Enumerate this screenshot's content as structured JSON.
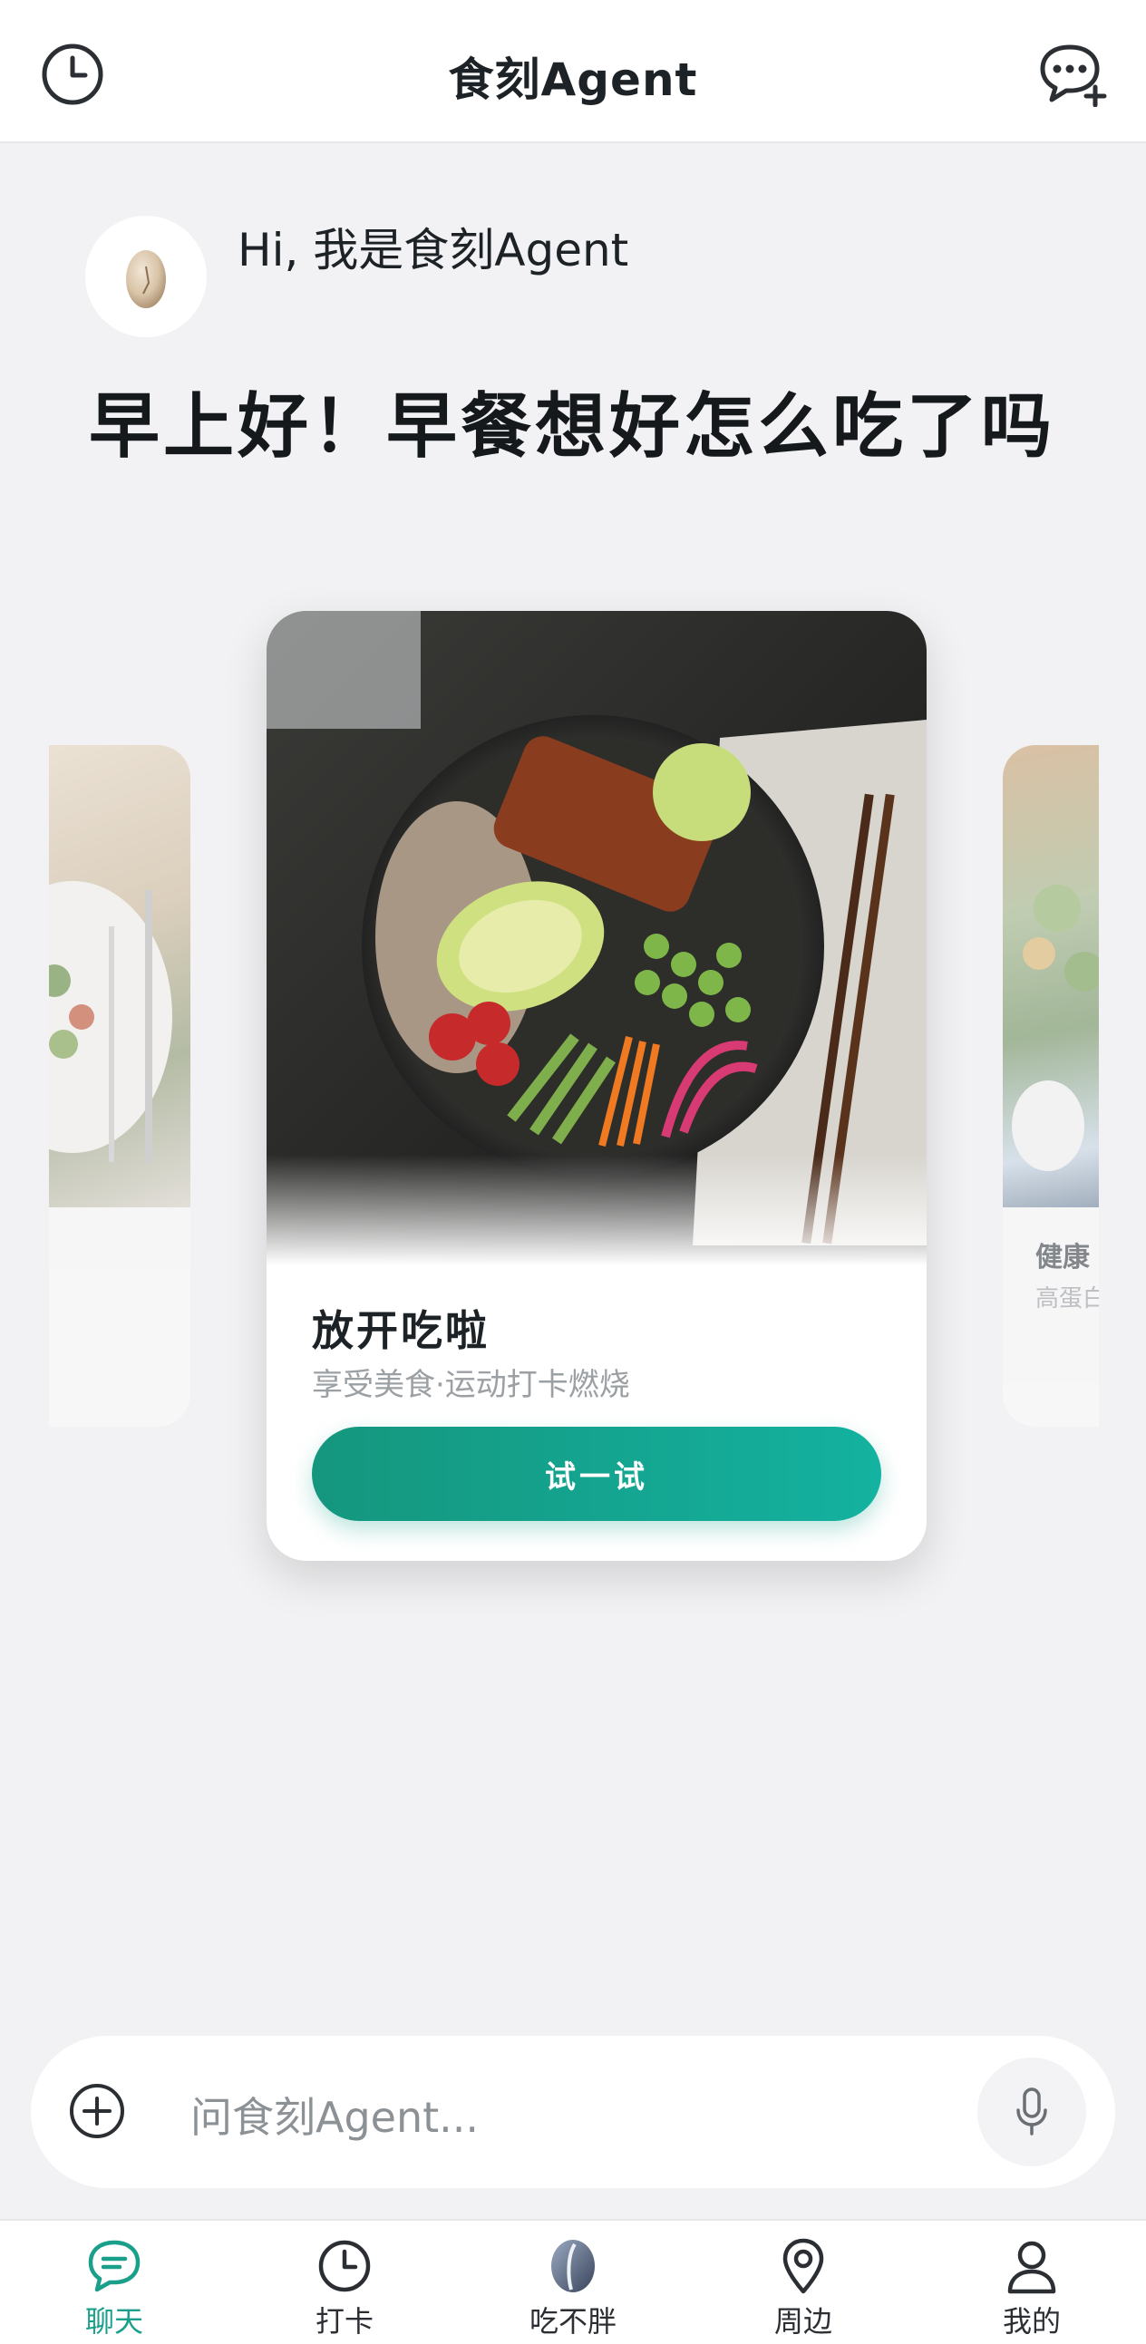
{
  "header": {
    "title": "食刻Agent",
    "history_icon": "clock-icon",
    "new_chat_icon": "chat-bubble-plus-icon"
  },
  "greeting": {
    "hi": "Hi, 我是食刻Agent",
    "headline": "早上好！早餐想好怎么吃了吗"
  },
  "cards": {
    "main": {
      "title": "放开吃啦",
      "subtitle": "享受美食·运动打卡燃烧",
      "button": "试一试"
    },
    "right": {
      "title": "健康",
      "subtitle": "高蛋白"
    }
  },
  "input": {
    "placeholder": "问食刻Agent...",
    "plus_icon": "plus-circle-icon",
    "mic_icon": "microphone-icon"
  },
  "nav": {
    "items": [
      {
        "label": "聊天",
        "icon": "chat-icon",
        "active": true
      },
      {
        "label": "打卡",
        "icon": "clock-icon",
        "active": false
      },
      {
        "label": "吃不胖",
        "icon": "leaf-logo-icon",
        "active": false
      },
      {
        "label": "周边",
        "icon": "location-pin-icon",
        "active": false
      },
      {
        "label": "我的",
        "icon": "user-icon",
        "active": false
      }
    ]
  },
  "colors": {
    "accent": "#1aa08a",
    "background": "#f2f2f4"
  }
}
